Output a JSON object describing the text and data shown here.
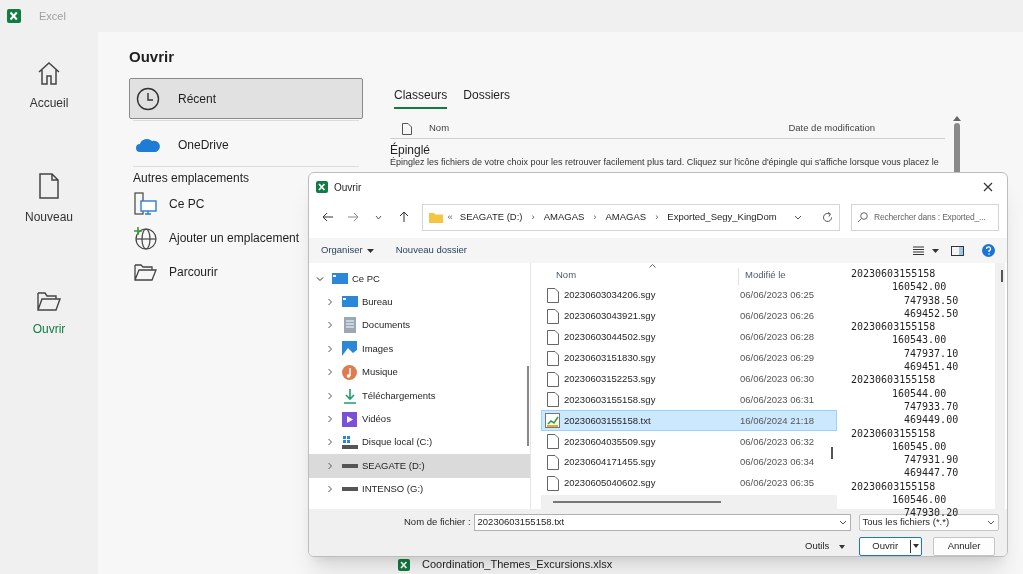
{
  "app": {
    "title": "Excel"
  },
  "nav": [
    {
      "label": "Accueil",
      "selected": false
    },
    {
      "label": "Nouveau",
      "selected": false
    },
    {
      "label": "Ouvrir",
      "selected": true
    }
  ],
  "open_page": {
    "title": "Ouvrir",
    "locations": [
      {
        "label": "Récent",
        "selected": true
      },
      {
        "label": "OneDrive",
        "selected": false
      }
    ],
    "other_heading": "Autres emplacements",
    "other_locations": [
      "Ce PC",
      "Ajouter un emplacement",
      "Parcourir"
    ],
    "tabs": [
      {
        "label": "Classeurs",
        "selected": true
      },
      {
        "label": "Dossiers",
        "selected": false
      }
    ],
    "columns": [
      "Nom",
      "Date de modification"
    ],
    "pinned_heading": "Épinglé",
    "pinned_text": "Épinglez les fichiers de votre choix pour les retrouver facilement plus tard. Cliquez sur l'icône d'épingle qui s'affiche lorsque vous placez le",
    "recent_file": "Coordination_Themes_Excursions.xlsx"
  },
  "dialog": {
    "title": "Ouvrir",
    "path": [
      {
        "kind": "overflow",
        "text": "«"
      },
      {
        "kind": "folder",
        "text": "SEAGATE (D:)"
      },
      {
        "kind": "separator",
        "text": "›"
      },
      {
        "kind": "folder",
        "text": "AMAGAS"
      },
      {
        "kind": "separator",
        "text": "›"
      },
      {
        "kind": "folder",
        "text": "AMAGAS"
      },
      {
        "kind": "separator",
        "text": "›"
      },
      {
        "kind": "folder",
        "text": "Exported_Segy_KingDom"
      }
    ],
    "search_placeholder": "Rechercher dans : Exported_...",
    "commands": {
      "organize": "Organiser",
      "new_folder": "Nouveau dossier"
    },
    "tree": [
      {
        "label": "Ce PC",
        "expanded": true,
        "selected": false,
        "children": [
          {
            "label": "Bureau",
            "expanded": false,
            "selected": false
          },
          {
            "label": "Documents",
            "expanded": false,
            "selected": false
          },
          {
            "label": "Images",
            "expanded": false,
            "selected": false
          },
          {
            "label": "Musique",
            "expanded": false,
            "selected": false
          },
          {
            "label": "Téléchargements",
            "expanded": false,
            "selected": false
          },
          {
            "label": "Vidéos",
            "expanded": false,
            "selected": false
          },
          {
            "label": "Disque local (C:)",
            "expanded": false,
            "selected": false
          },
          {
            "label": "SEAGATE (D:)",
            "expanded": false,
            "selected": true
          },
          {
            "label": "INTENSO (G:)",
            "expanded": false,
            "selected": false
          }
        ]
      }
    ],
    "file_columns": [
      "Nom",
      "Modifié le"
    ],
    "files": [
      {
        "name": "20230603034206.sgy",
        "modified": "06/06/2023 06:25",
        "kind": "file",
        "selected": false
      },
      {
        "name": "20230603043921.sgy",
        "modified": "06/06/2023 06:26",
        "kind": "file",
        "selected": false
      },
      {
        "name": "20230603044502.sgy",
        "modified": "06/06/2023 06:28",
        "kind": "file",
        "selected": false
      },
      {
        "name": "20230603151830.sgy",
        "modified": "06/06/2023 06:29",
        "kind": "file",
        "selected": false
      },
      {
        "name": "20230603152253.sgy",
        "modified": "06/06/2023 06:30",
        "kind": "file",
        "selected": false
      },
      {
        "name": "20230603155158.sgy",
        "modified": "06/06/2023 06:31",
        "kind": "file",
        "selected": false
      },
      {
        "name": "20230603155158.txt",
        "modified": "16/06/2024 21:18",
        "kind": "text",
        "selected": true
      },
      {
        "name": "20230604035509.sgy",
        "modified": "06/06/2023 06:32",
        "kind": "file",
        "selected": false
      },
      {
        "name": "20230604171455.sgy",
        "modified": "06/06/2023 06:34",
        "kind": "file",
        "selected": false
      },
      {
        "name": "20230605040602.sgy",
        "modified": "06/06/2023 06:35",
        "kind": "file",
        "selected": false
      }
    ],
    "preview": [
      {
        "id": "20230603155158",
        "values": [
          "160542.00",
          "747938.50",
          "469452.50"
        ]
      },
      {
        "id": "20230603155158",
        "values": [
          "160543.00",
          "747937.10",
          "469451.40"
        ]
      },
      {
        "id": "20230603155158",
        "values": [
          "160544.00",
          "747933.70",
          "469449.00"
        ]
      },
      {
        "id": "20230603155158",
        "values": [
          "160545.00",
          "747931.90",
          "469447.70"
        ]
      },
      {
        "id": "20230603155158",
        "values": [
          "160546.00",
          "747930.20"
        ]
      }
    ],
    "filename_label": "Nom de fichier :",
    "filename": "20230603155158.txt",
    "filter": "Tous les fichiers (*.*)",
    "tools": "Outils",
    "open_button": "Ouvrir",
    "cancel_button": "Annuler"
  }
}
